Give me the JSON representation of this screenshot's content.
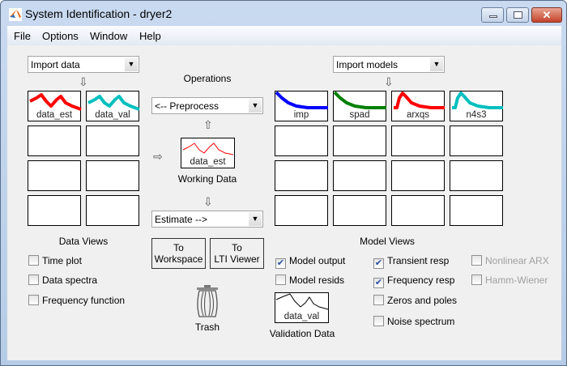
{
  "window": {
    "title": "System Identification - dryer2",
    "controls": {
      "minimize": "minimize-icon",
      "maximize": "maximize-icon",
      "close": "close-icon"
    }
  },
  "menu": [
    "File",
    "Options",
    "Window",
    "Help"
  ],
  "data": {
    "import_dropdown": "Import data",
    "slots": [
      {
        "name": "data_est",
        "color": "#ff0000"
      },
      {
        "name": "data_val",
        "color": "#00bfbf"
      }
    ],
    "views_label": "Data Views",
    "views": [
      {
        "label": "Time plot",
        "checked": false
      },
      {
        "label": "Data spectra",
        "checked": false
      },
      {
        "label": "Frequency function",
        "checked": false
      }
    ]
  },
  "operations": {
    "label": "Operations",
    "preprocess": "<-- Preprocess",
    "working_data_name": "data_est",
    "working_data_label": "Working Data",
    "estimate": "Estimate -->",
    "to_workspace": [
      "To",
      "Workspace"
    ],
    "to_lti": [
      "To",
      "LTI Viewer"
    ],
    "trash": "Trash"
  },
  "models": {
    "import_dropdown": "Import models",
    "slots": [
      {
        "name": "imp",
        "color": "#0000ff"
      },
      {
        "name": "spad",
        "color": "#008000"
      },
      {
        "name": "arxqs",
        "color": "#ff0000"
      },
      {
        "name": "n4s3",
        "color": "#00bfbf"
      }
    ],
    "views_label": "Model Views",
    "views": [
      {
        "label": "Model output",
        "checked": true
      },
      {
        "label": "Model resids",
        "checked": false
      },
      {
        "label": "Transient resp",
        "checked": true
      },
      {
        "label": "Frequency resp",
        "checked": true
      },
      {
        "label": "Zeros and poles",
        "checked": false
      },
      {
        "label": "Noise spectrum",
        "checked": false
      },
      {
        "label": "Nonlinear ARX",
        "checked": false,
        "disabled": true
      },
      {
        "label": "Hamm-Wiener",
        "checked": false,
        "disabled": true
      }
    ],
    "validation_data_name": "data_val",
    "validation_label": "Validation Data"
  }
}
